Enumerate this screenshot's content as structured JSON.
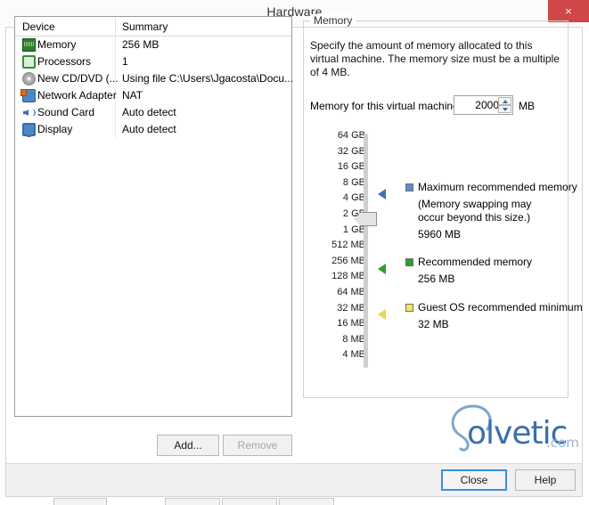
{
  "window": {
    "title": "Hardware",
    "close_label": "×"
  },
  "device_list": {
    "columns": {
      "device": "Device",
      "summary": "Summary"
    },
    "rows": [
      {
        "icon": "memory-icon",
        "label": "Memory",
        "summary": "256 MB"
      },
      {
        "icon": "processor-icon",
        "label": "Processors",
        "summary": "1"
      },
      {
        "icon": "cd-dvd-icon",
        "label": "New CD/DVD (...",
        "summary": "Using file C:\\Users\\Jgacosta\\Docu..."
      },
      {
        "icon": "network-adapter-icon",
        "label": "Network Adapter",
        "summary": "NAT"
      },
      {
        "icon": "sound-card-icon",
        "label": "Sound Card",
        "summary": "Auto detect"
      },
      {
        "icon": "display-icon",
        "label": "Display",
        "summary": "Auto detect"
      }
    ],
    "add_label": "Add...",
    "remove_label": "Remove"
  },
  "memory_panel": {
    "group_title": "Memory",
    "description": "Specify the amount of memory allocated to this virtual machine. The memory size must be a multiple of 4 MB.",
    "field_label": "Memory for this virtual machine:",
    "value": "2000",
    "unit": "MB",
    "scale_labels": [
      "64 GB",
      "32 GB",
      "16 GB",
      "8 GB",
      "4 GB",
      "2 GB",
      "1 GB",
      "512 MB",
      "256 MB",
      "128 MB",
      "64 MB",
      "32 MB",
      "16 MB",
      "8 MB",
      "4 MB"
    ],
    "slider_position_label": "2 GB",
    "legend": [
      {
        "marker_color": "#5b8fd0",
        "arrow_color": "#3f72b5",
        "title": "Maximum recommended memory",
        "note": "(Memory swapping may\noccur beyond this size.)",
        "value": "5960 MB"
      },
      {
        "marker_color": "#2f9e2f",
        "arrow_color": "#2f9e2f",
        "title": "Recommended memory",
        "note": "",
        "value": "256 MB"
      },
      {
        "marker_color": "#f2e85c",
        "arrow_color": "#e8d94a",
        "title": "Guest OS recommended minimum",
        "note": "",
        "value": "32 MB"
      }
    ]
  },
  "footer": {
    "close_label": "Close",
    "help_label": "Help"
  },
  "watermark": {
    "text": "olvetic",
    "suffix": ".com"
  }
}
